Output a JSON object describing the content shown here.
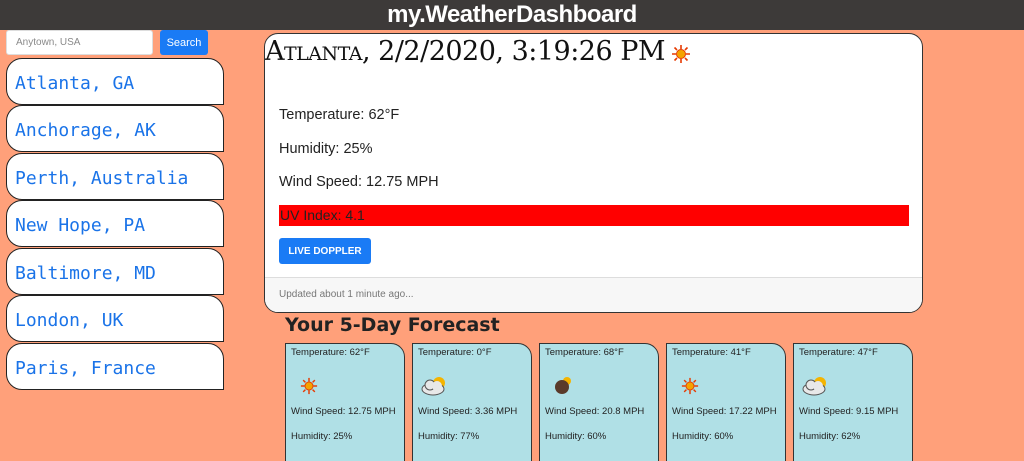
{
  "app": {
    "title": "my.WeatherDashboard"
  },
  "search": {
    "placeholder": "Anytown, USA",
    "button_label": "Search"
  },
  "cities": [
    "Atlanta, GA",
    "Anchorage, AK",
    "Perth, Australia",
    "New Hope, PA",
    "Baltimore, MD",
    "London, UK",
    "Paris, France"
  ],
  "current": {
    "heading": "Atlanta, 2/2/2020, 3:19:26 PM",
    "icon": "sun-icon",
    "temperature": "Temperature: 62°F",
    "humidity": "Humidity: 25%",
    "wind": "Wind Speed: 12.75 MPH",
    "uv": "UV Index: 4.1",
    "uv_color": "#ff0000",
    "doppler_label": "LIVE DOPPLER",
    "updated": "Updated about 1 minute ago..."
  },
  "forecast": {
    "title": "Your 5-Day Forecast",
    "days": [
      {
        "temp": "Temperature: 62°F",
        "icon": "sun-icon",
        "wind": "Wind Speed: 12.75 MPH",
        "humidity": "Humidity: 25%"
      },
      {
        "temp": "Temperature: 0°F",
        "icon": "cloud-icon",
        "wind": "Wind Speed: 3.36 MPH",
        "humidity": "Humidity: 77%"
      },
      {
        "temp": "Temperature: 68°F",
        "icon": "dark-cloud-icon",
        "wind": "Wind Speed: 20.8 MPH",
        "humidity": "Humidity: 60%"
      },
      {
        "temp": "Temperature: 41°F",
        "icon": "sun-icon",
        "wind": "Wind Speed: 17.22 MPH",
        "humidity": "Humidity: 60%"
      },
      {
        "temp": "Temperature: 47°F",
        "icon": "cloud-icon",
        "wind": "Wind Speed: 9.15 MPH",
        "humidity": "Humidity: 62%"
      }
    ]
  },
  "colors": {
    "background": "#FFA07A",
    "header": "#3d3a39",
    "accent": "#1a7bf5",
    "city_text": "#1a73e8",
    "forecast_card": "#b0e0e6"
  }
}
